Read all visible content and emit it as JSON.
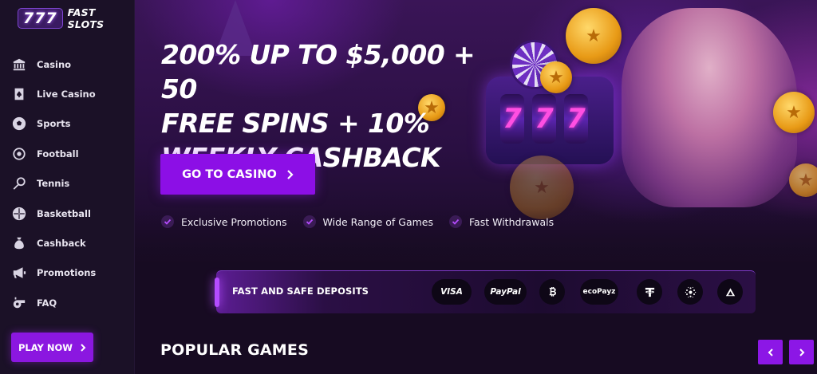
{
  "brand": {
    "logo_number": "777",
    "logo_text": "FAST SLOTS"
  },
  "sidebar": {
    "items": [
      {
        "label": "Casino",
        "icon": "casino-building-icon"
      },
      {
        "label": "Live Casino",
        "icon": "card-spade-icon"
      },
      {
        "label": "Sports",
        "icon": "soccer-ball-icon"
      },
      {
        "label": "Football",
        "icon": "football-icon"
      },
      {
        "label": "Tennis",
        "icon": "tennis-racket-icon"
      },
      {
        "label": "Basketball",
        "icon": "basketball-icon"
      },
      {
        "label": "Cashback",
        "icon": "money-bag-icon"
      },
      {
        "label": "Promotions",
        "icon": "megaphone-icon"
      },
      {
        "label": "FAQ",
        "icon": "whistle-icon"
      }
    ],
    "play_now_label": "PLAY NOW"
  },
  "hero": {
    "headline_line1": "200% UP TO $5,000 + 50",
    "headline_line2": "FREE SPINS + 10%",
    "headline_line3": "WEEKLY CASHBACK",
    "cta_label": "GO TO CASINO",
    "reel_symbols": [
      "7",
      "7",
      "7"
    ],
    "features": [
      "Exclusive Promotions",
      "Wide Range of Games",
      "Fast Withdrawals"
    ]
  },
  "deposits": {
    "title": "FAST AND SAFE DEPOSITS",
    "methods": [
      {
        "label": "VISA",
        "icon": "visa-icon"
      },
      {
        "label": "PayPal",
        "icon": "paypal-icon"
      },
      {
        "label": "",
        "icon": "bitcoin-icon"
      },
      {
        "label": "ecoPayz",
        "icon": "ecopayz-icon"
      },
      {
        "label": "",
        "icon": "tether-icon"
      },
      {
        "label": "",
        "icon": "cardano-icon"
      },
      {
        "label": "",
        "icon": "tron-icon"
      }
    ]
  },
  "popular": {
    "title": "POPULAR GAMES"
  },
  "colors": {
    "accent": "#8c0fe6",
    "sidebar_bg": "#1b1127",
    "page_bg": "#170b22"
  }
}
